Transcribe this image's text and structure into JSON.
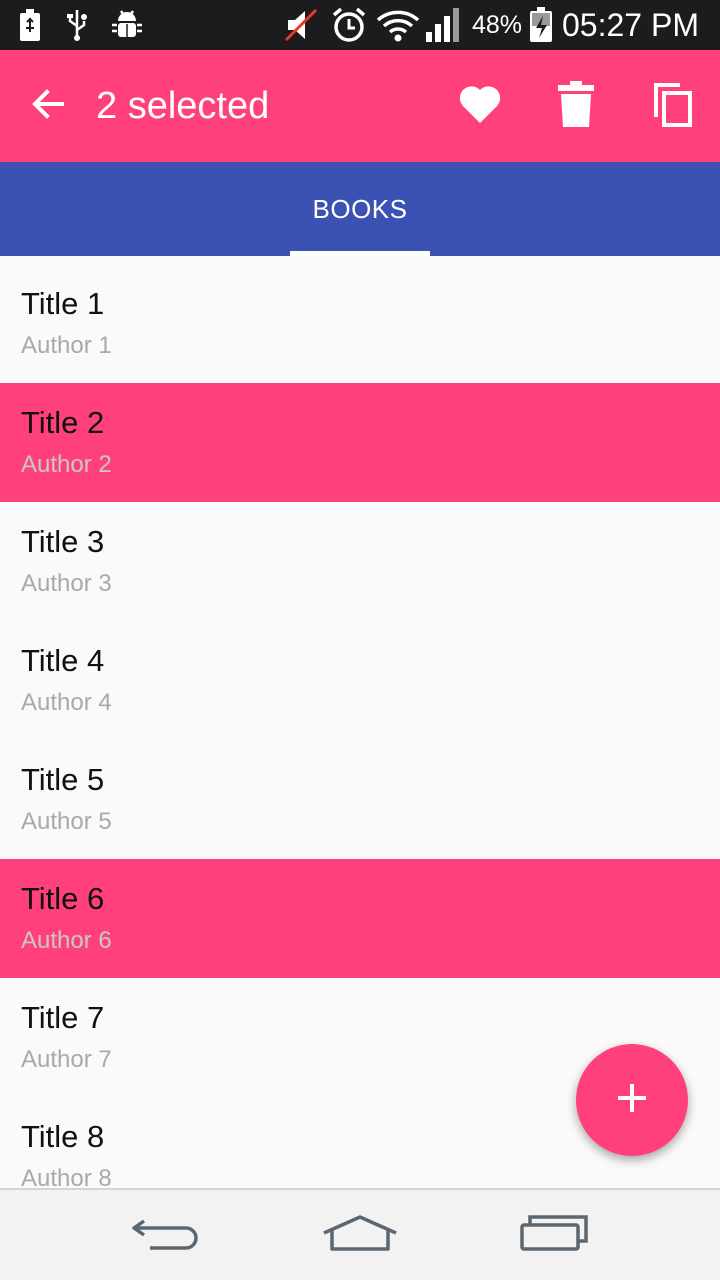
{
  "status_bar": {
    "icons": [
      "battery-saver-icon",
      "usb-icon",
      "android-debug-icon",
      "mute-icon",
      "alarm-icon",
      "wifi-icon",
      "signal-icon",
      "battery-charging-icon"
    ],
    "battery_percent": "48%",
    "time": "05:27 PM"
  },
  "action_bar": {
    "title": "2 selected",
    "icons": [
      "back-arrow-icon",
      "heart-icon",
      "trash-icon",
      "copy-icon"
    ]
  },
  "tabs": [
    {
      "label": "BOOKS",
      "active": true
    }
  ],
  "books": [
    {
      "title": "Title 1",
      "author": "Author 1",
      "selected": false
    },
    {
      "title": "Title 2",
      "author": "Author 2",
      "selected": true
    },
    {
      "title": "Title 3",
      "author": "Author 3",
      "selected": false
    },
    {
      "title": "Title 4",
      "author": "Author 4",
      "selected": false
    },
    {
      "title": "Title 5",
      "author": "Author 5",
      "selected": false
    },
    {
      "title": "Title 6",
      "author": "Author 6",
      "selected": true
    },
    {
      "title": "Title 7",
      "author": "Author 7",
      "selected": false
    },
    {
      "title": "Title 8",
      "author": "Author 8",
      "selected": false
    }
  ],
  "fab": {
    "icon": "plus-icon"
  },
  "nav_bar": {
    "icons": [
      "nav-back-icon",
      "home-icon",
      "recents-icon"
    ]
  },
  "colors": {
    "accent": "#ff407a",
    "primary": "#3c51b4",
    "status_bar": "#1c1c1c",
    "background": "#fafafa"
  }
}
